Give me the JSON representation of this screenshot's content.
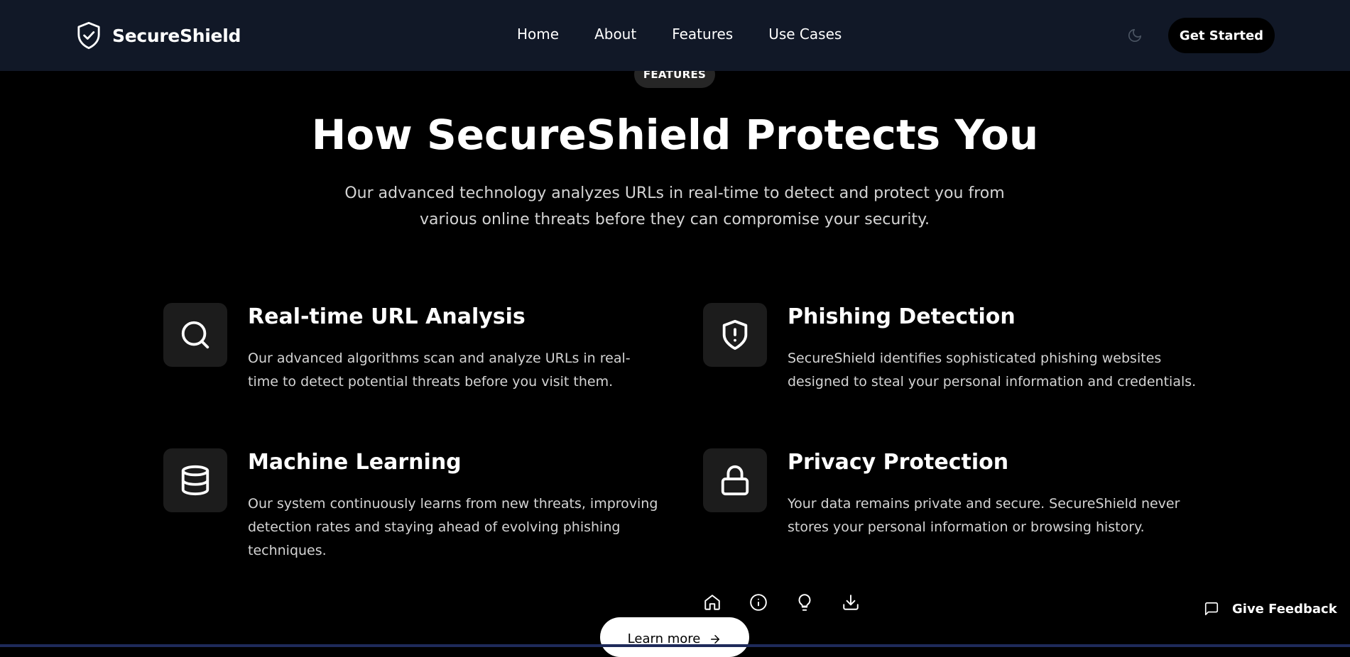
{
  "header": {
    "brand": "SecureShield",
    "brand_icon": "shield-check-icon",
    "nav": [
      "Home",
      "About",
      "Features",
      "Use Cases"
    ],
    "theme_toggle_icon": "moon-icon",
    "cta_label": "Get Started",
    "background": "#111827"
  },
  "section": {
    "badge": "FEATURES",
    "title": "How SecureShield Protects You",
    "subtitle": "Our advanced technology analyzes URLs in real-time to detect and protect you from various online threats before they can compromise your security."
  },
  "features": [
    {
      "icon": "search-icon",
      "title": "Real-time URL Analysis",
      "description": "Our advanced algorithms scan and analyze URLs in real-time to detect potential threats before you visit them."
    },
    {
      "icon": "shield-alert-icon",
      "title": "Phishing Detection",
      "description": "SecureShield identifies sophisticated phishing websites designed to steal your personal information and credentials."
    },
    {
      "icon": "database-icon",
      "title": "Machine Learning",
      "description": "Our system continuously learns from new threats, improving detection rates and staying ahead of evolving phishing techniques."
    },
    {
      "icon": "lock-icon",
      "title": "Privacy Protection",
      "description": "Your data remains private and secure. SecureShield never stores your personal information or browsing history."
    }
  ],
  "bottom_nav_icons": [
    "home-icon",
    "info-icon",
    "lightbulb-icon",
    "download-icon"
  ],
  "learn_more": {
    "label": "Learn more",
    "icon": "arrow-right-icon"
  },
  "feedback": {
    "label": "Give Feedback",
    "icon": "message-square-icon"
  }
}
